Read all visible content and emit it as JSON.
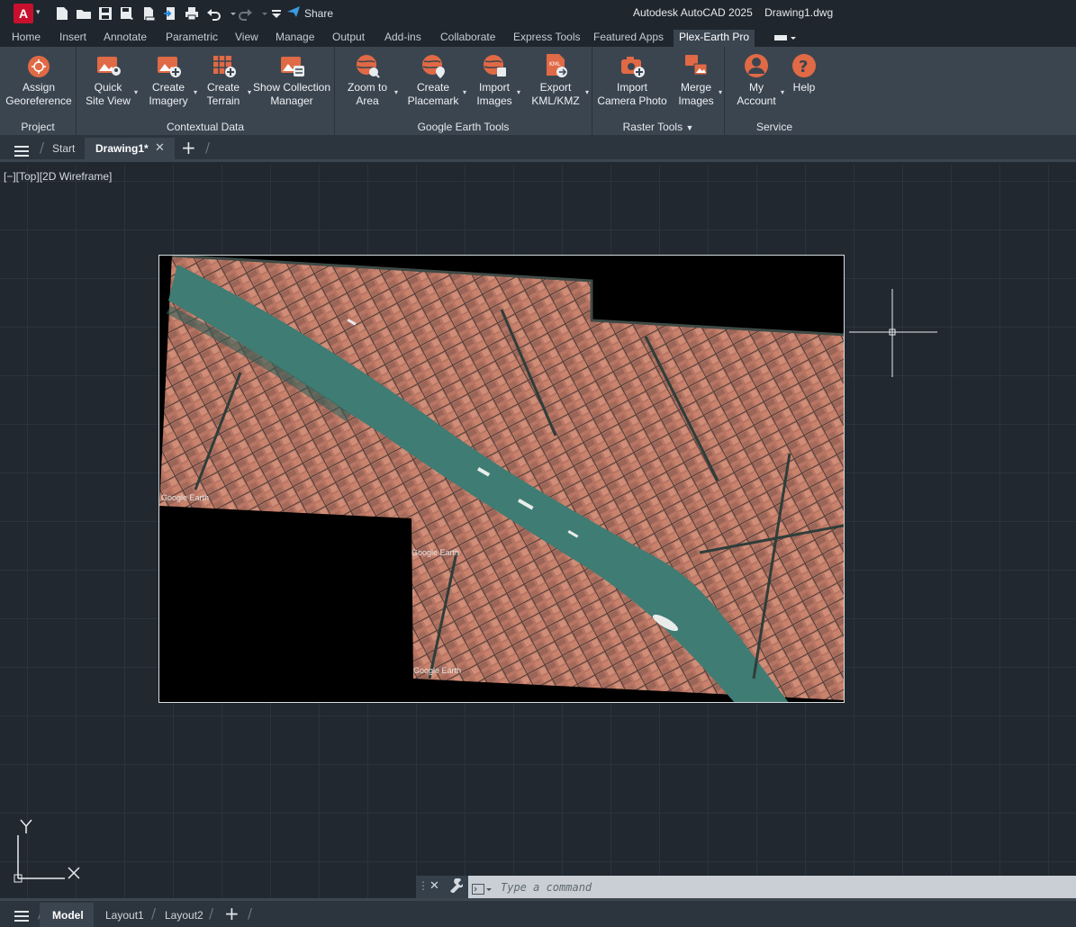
{
  "app": {
    "logo_letter": "A",
    "title": "Autodesk AutoCAD 2025",
    "document": "Drawing1.dwg"
  },
  "quick_access": {
    "share_label": "Share",
    "icons": [
      "new-file-icon",
      "open-folder-icon",
      "save-icon",
      "save-as-icon",
      "export-icon",
      "publish-icon",
      "print-icon",
      "undo-icon",
      "redo-icon",
      "customize-icon"
    ]
  },
  "ribbon_tabs": [
    "Home",
    "Insert",
    "Annotate",
    "Parametric",
    "View",
    "Manage",
    "Output",
    "Add-ins",
    "Collaborate",
    "Express Tools",
    "Featured Apps",
    "Plex-Earth Pro"
  ],
  "active_tab": "Plex-Earth Pro",
  "panels": {
    "project": {
      "title": "Project",
      "buttons": [
        {
          "label": "Assign\nGeoreference"
        }
      ]
    },
    "contextual": {
      "title": "Contextual Data",
      "buttons": [
        {
          "label": "Quick\nSite View"
        },
        {
          "label": "Create\nImagery"
        },
        {
          "label": "Create\nTerrain"
        },
        {
          "label": "Show Collection\nManager"
        }
      ]
    },
    "google": {
      "title": "Google Earth Tools",
      "buttons": [
        {
          "label": "Zoom to\nArea"
        },
        {
          "label": "Create\nPlacemark"
        },
        {
          "label": "Import\nImages"
        },
        {
          "label": "Export\nKML/KMZ"
        }
      ]
    },
    "raster": {
      "title": "Raster Tools",
      "buttons": [
        {
          "label": "Import\nCamera Photo"
        },
        {
          "label": "Merge\nImages"
        }
      ]
    },
    "service": {
      "title": "Service",
      "buttons": [
        {
          "label": "My\nAccount"
        },
        {
          "label": "Help"
        }
      ]
    }
  },
  "doc_tabs": {
    "start": "Start",
    "drawing": "Drawing1*"
  },
  "viewport": {
    "label": "[−][Top][2D Wireframe]"
  },
  "imagery": {
    "watermark": "Google Earth"
  },
  "ucs": {
    "y_label": "Y",
    "x_label": "X"
  },
  "command": {
    "placeholder": "Type a command"
  },
  "layout_tabs": {
    "model": "Model",
    "layout1": "Layout1",
    "layout2": "Layout2"
  },
  "colors": {
    "accent": "#e06a45",
    "ribbon_bg": "#3b4550",
    "canvas_bg": "#212830",
    "water": "#3f7c73"
  }
}
